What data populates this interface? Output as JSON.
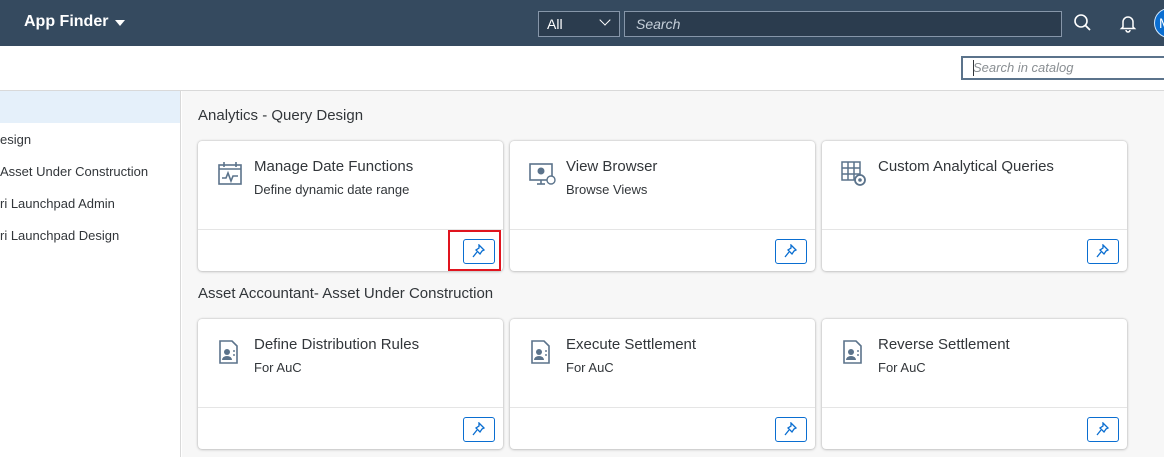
{
  "shell": {
    "app_title": "App Finder",
    "scope_value": "All",
    "search_placeholder": "Search",
    "user_initial": "M"
  },
  "catalog": {
    "search_placeholder": "Search in catalog"
  },
  "sidebar": {
    "items": [
      {
        "label": ""
      },
      {
        "label": "esign"
      },
      {
        "label": "Asset Under Construction"
      },
      {
        "label": "ri Launchpad Admin"
      },
      {
        "label": "ri Launchpad Design"
      }
    ]
  },
  "groups": [
    {
      "title": "Analytics - Query Design",
      "tiles": [
        {
          "title": "Manage Date Functions",
          "subtitle": "Define dynamic date range",
          "icon": "calendar-chart-icon"
        },
        {
          "title": "View Browser",
          "subtitle": "Browse Views",
          "icon": "monitor-view-icon"
        },
        {
          "title": "Custom Analytical Queries",
          "subtitle": "",
          "icon": "grid-gear-icon"
        }
      ]
    },
    {
      "title": "Asset Accountant- Asset Under Construction",
      "tiles": [
        {
          "title": "Define Distribution Rules",
          "subtitle": "For AuC",
          "icon": "document-person-icon"
        },
        {
          "title": "Execute Settlement",
          "subtitle": "For AuC",
          "icon": "document-person-icon"
        },
        {
          "title": "Reverse Settlement",
          "subtitle": "For AuC",
          "icon": "document-person-icon"
        }
      ]
    }
  ],
  "colors": {
    "shell": "#354a5f",
    "accent": "#0a6ed1",
    "highlight": "#e0141e",
    "selected": "#e5f0fa"
  }
}
